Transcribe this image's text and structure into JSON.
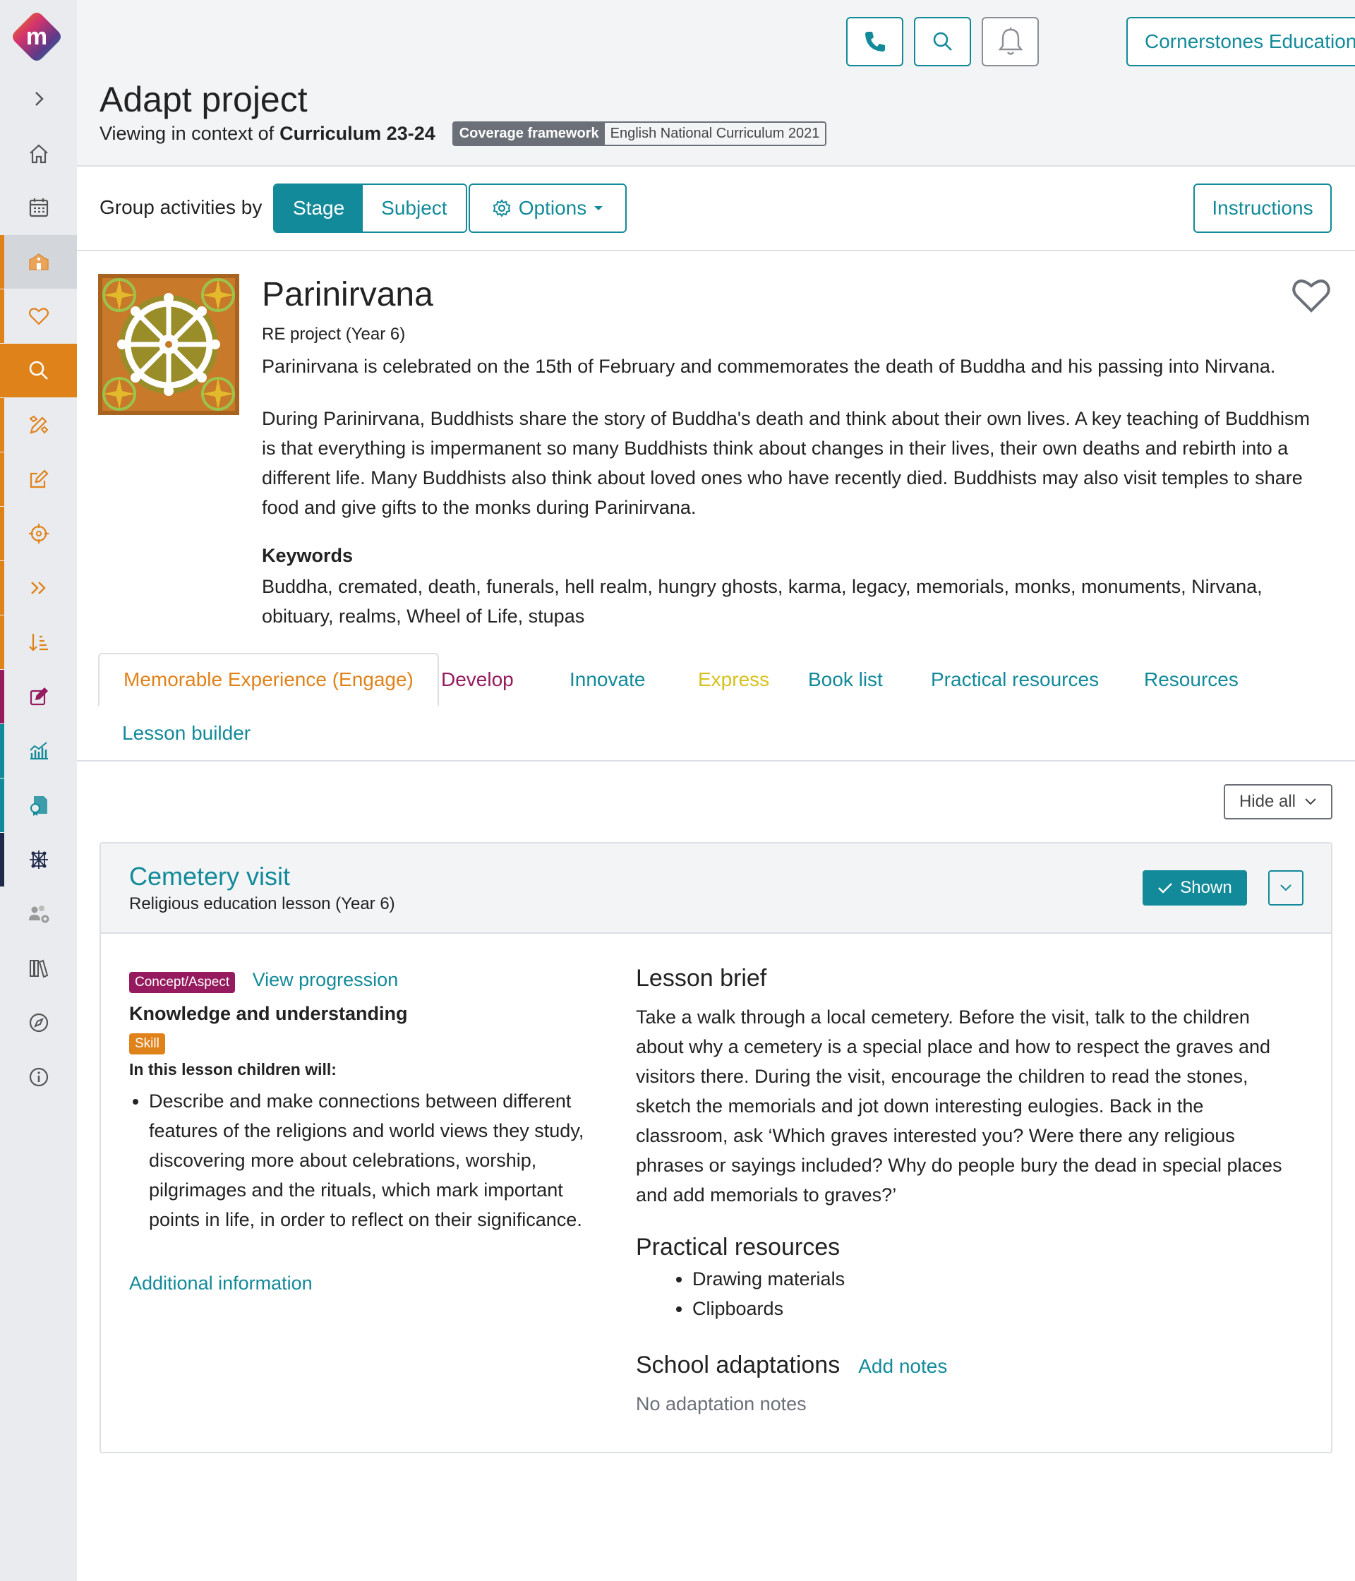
{
  "header": {
    "org_name": "Cornerstones Education",
    "page_title": "Adapt project",
    "context_prefix": "Viewing in context of",
    "context_name": "Curriculum 23-24",
    "coverage_label": "Coverage framework",
    "coverage_value": "English National Curriculum 2021"
  },
  "toolbar": {
    "group_label": "Group activities by",
    "stage_label": "Stage",
    "subject_label": "Subject",
    "options_label": "Options",
    "instructions_label": "Instructions"
  },
  "project": {
    "title": "Parinirvana",
    "subtitle": "RE project (Year 6)",
    "desc1": "Parinirvana is celebrated on the 15th of February and commemorates the death of Buddha and his passing into Nirvana.",
    "desc2": "During Parinirvana, Buddhists share the story of Buddha's death and think about their own lives. A key teaching of Buddhism is that everything is impermanent so many Buddhists think about changes in their lives, their own deaths and rebirth into a different life. Many Buddhists also think about loved ones who have recently died. Buddhists may also visit temples to share food and give gifts to the monks during Parinirvana.",
    "keywords_title": "Keywords",
    "keywords": "Buddha, cremated, death, funerals, hell realm, hungry ghosts, karma, legacy, memorials, monks, monuments, Nirvana, obituary, realms, Wheel of Life, stupas"
  },
  "tabs": [
    {
      "label": "Memorable Experience (Engage)",
      "color": "#e0821a"
    },
    {
      "label": "Develop",
      "color": "#951b5e"
    },
    {
      "label": "Innovate",
      "color": "#128a99"
    },
    {
      "label": "Express",
      "color": "#d6c21e"
    },
    {
      "label": "Book list",
      "color": "#128a99"
    },
    {
      "label": "Practical resources",
      "color": "#128a99"
    },
    {
      "label": "Resources",
      "color": "#128a99"
    },
    {
      "label": "Lesson builder",
      "color": "#128a99"
    }
  ],
  "hide_all_label": "Hide all",
  "lesson": {
    "title": "Cemetery visit",
    "subtitle": "Religious education lesson (Year 6)",
    "shown_label": "Shown",
    "concept_badge": "Concept/Aspect",
    "view_progression": "View progression",
    "knowledge": "Knowledge and understanding",
    "skill_badge": "Skill",
    "children_will": "In this lesson children will:",
    "objective": "Describe and make connections between different features of the religions and world views they study, discovering more about celebrations, worship, pilgrimages and the rituals, which mark important points in life, in order to reflect on their significance.",
    "additional_info": "Additional information",
    "brief_title": "Lesson brief",
    "brief": "Take a walk through a local cemetery. Before the visit, talk to the children about why a cemetery is a special place and how to respect the graves and visitors there. During the visit, encourage the children to read the stones, sketch the memorials and jot down interesting eulogies. Back in the classroom, ask ‘Which graves interested you? Were there any religious phrases or sayings included? Why do people bury the dead in special places and add memorials to graves?’",
    "practical_title": "Practical resources",
    "practical_items": [
      "Drawing materials",
      "Clipboards"
    ],
    "adapt_title": "School adaptations",
    "add_notes": "Add notes",
    "no_notes": "No adaptation notes"
  },
  "colors": {
    "teal": "#128a99",
    "orange": "#e0821a",
    "magenta": "#951b5e",
    "navy": "#1f2a4a"
  }
}
